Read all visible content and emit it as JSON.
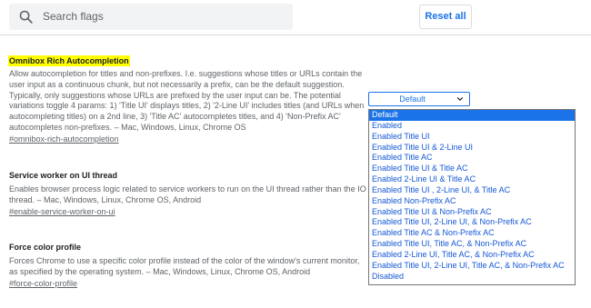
{
  "header": {
    "search_placeholder": "Search flags",
    "reset_label": "Reset all"
  },
  "flags": [
    {
      "title": "Omnibox Rich Autocompletion",
      "description": "Allow autocompletion for titles and non-prefixes. I.e. suggestions whose titles or URLs contain the user input as a continuous chunk, but not necessarily a prefix, can be the default suggestion. Typically, only suggestions whose URLs are prefixed by the user input can be. The potential variations toggle 4 params: 1) 'Title UI' displays titles, 2) '2-Line UI' includes titles (and URLs when autocompleting titles) on a 2nd line, 3) 'Title AC' autocompletes titles, and 4) 'Non-Prefix AC' autocompletes non-prefixes. – Mac, Windows, Linux, Chrome OS",
      "anchor": "#omnibox-rich-autocompletion"
    },
    {
      "title": "Service worker on UI thread",
      "description": "Enables browser process logic related to service workers to run on the UI thread rather than the IO thread. – Mac, Windows, Linux, Chrome OS, Android",
      "anchor": "#enable-service-worker-on-ui"
    },
    {
      "title": "Force color profile",
      "description": "Forces Chrome to use a specific color profile instead of the color of the window's current monitor, as specified by the operating system. – Mac, Windows, Linux, Chrome OS, Android",
      "anchor": "#force-color-profile"
    }
  ],
  "dropdown": {
    "selected": "Default",
    "options": [
      "Default",
      "Enabled",
      "Enabled Title UI",
      "Enabled Title UI & 2-Line UI",
      "Enabled Title AC",
      "Enabled Title UI & Title AC",
      "Enabled 2-Line UI & Title AC",
      "Enabled Title UI , 2-Line UI, & Title AC",
      "Enabled Non-Prefix AC",
      "Enabled Title UI & Non-Prefix AC",
      "Enabled Title UI, 2-Line UI, & Non-Prefix AC",
      "Enabled Title AC & Non-Prefix AC",
      "Enabled Title UI, Title AC, & Non-Prefix AC",
      "Enabled 2-Line UI, Title AC, & Non-Prefix AC",
      "Enabled Title UI, 2-Line UI, Title AC, & Non-Prefix AC",
      "Disabled"
    ]
  },
  "colors": {
    "accent": "#1a73e8",
    "highlight": "#ffff00",
    "search_bg": "#f1f3f4"
  }
}
